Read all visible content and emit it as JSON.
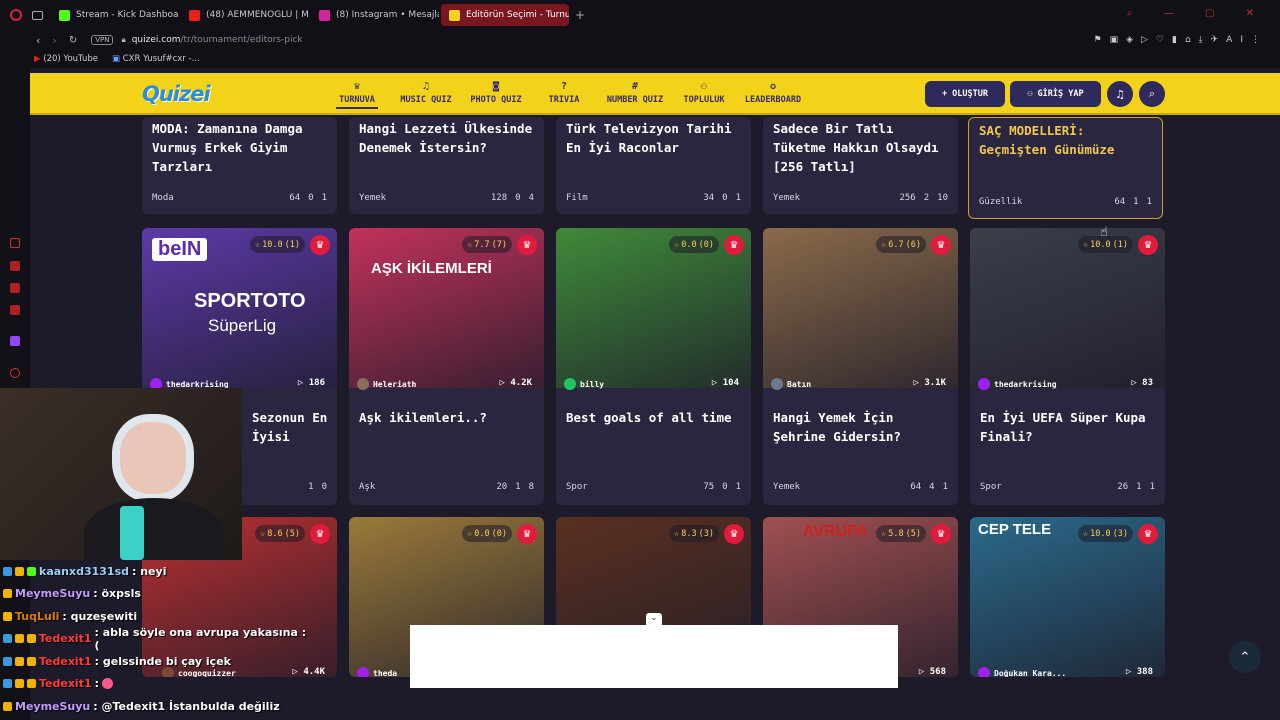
{
  "browser": {
    "tabs": [
      {
        "label": "Stream - Kick Dashboard",
        "color": "#53fc18"
      },
      {
        "label": "(48) AEMMENOGLU | Mar",
        "color": "#e62117"
      },
      {
        "label": "(8) Instagram • Mesajlar",
        "color": "#d6249f"
      },
      {
        "label": "Editörün Seçimi - Turnuva",
        "color": "#f3d31a"
      }
    ],
    "url_host": "quizei.com",
    "url_path": "/tr/tournament/editors-pick",
    "vpn_label": "VPN",
    "bookmarks": [
      "(20) YouTube",
      "CXR Yusuf#cxr -..."
    ]
  },
  "header": {
    "logo": "Quizei",
    "nav": [
      {
        "label": "TURNUVA",
        "icon": "trophy-icon"
      },
      {
        "label": "MUSIC QUIZ",
        "icon": "music-icon"
      },
      {
        "label": "PHOTO QUIZ",
        "icon": "camera-icon"
      },
      {
        "label": "TRIVIA",
        "icon": "question-icon"
      },
      {
        "label": "NUMBER QUIZ",
        "icon": "hash-icon"
      },
      {
        "label": "TOPLULUK",
        "icon": "users-icon"
      },
      {
        "label": "LEADERBOARD",
        "icon": "medal-icon"
      }
    ],
    "create_label": "OLUŞTUR",
    "login_label": "GİRİŞ YAP"
  },
  "top_row": [
    {
      "title": "MODA: Zamanına Damga Vurmuş Erkek Giyim Tarzları",
      "category": "Moda",
      "items": "64",
      "comments": "0",
      "likes": "1"
    },
    {
      "title": "Hangi Lezzeti Ülkesinde Denemek İstersin?",
      "category": "Yemek",
      "items": "128",
      "comments": "0",
      "likes": "4"
    },
    {
      "title": "Türk Televizyon Tarihi En İyi Raconlar",
      "category": "Film",
      "items": "34",
      "comments": "0",
      "likes": "1"
    },
    {
      "title": "Sadece Bir Tatlı Tüketme Hakkın Olsaydı [256 Tatlı]",
      "category": "Yemek",
      "items": "256",
      "comments": "2",
      "likes": "10"
    },
    {
      "title": "SAÇ MODELLERİ: Geçmişten Günümüze",
      "category": "Güzellik",
      "items": "64",
      "comments": "1",
      "likes": "1"
    }
  ],
  "mid_row": [
    {
      "rating": "10.0",
      "votes": "(1)",
      "author": "thedarkrising",
      "plays": "186",
      "title": "Sezonun En İyisi",
      "category": "",
      "items": "",
      "comments": "1",
      "likes": "0",
      "thumb": "#5c3aa8",
      "av": "#a020f0"
    },
    {
      "rating": "7.7",
      "votes": "(7)",
      "author": "Heleriath",
      "plays": "4.2K",
      "title": "Aşk ikilemleri..?",
      "category": "Aşk",
      "items": "20",
      "comments": "1",
      "likes": "8",
      "thumb": "#c2325a",
      "av": "#8b6d5c"
    },
    {
      "rating": "0.0",
      "votes": "(0)",
      "author": "billy",
      "plays": "104",
      "title": "Best goals of all time",
      "category": "Spor",
      "items": "75",
      "comments": "0",
      "likes": "1",
      "thumb": "#3f8a3a",
      "av": "#22c55e"
    },
    {
      "rating": "6.7",
      "votes": "(6)",
      "author": "Batın",
      "plays": "3.1K",
      "title": "Hangi Yemek İçin Şehrine Gidersin?",
      "category": "Yemek",
      "items": "64",
      "comments": "4",
      "likes": "1",
      "thumb": "#8a6a4a",
      "av": "#6b7b8c"
    },
    {
      "rating": "10.0",
      "votes": "(1)",
      "author": "thedarkrising",
      "plays": "83",
      "title": "En İyi UEFA Süper Kupa Finali?",
      "category": "Spor",
      "items": "26",
      "comments": "1",
      "likes": "1",
      "thumb": "#3a3f48",
      "av": "#a020f0"
    }
  ],
  "bottom_row": [
    {
      "rating": "8.6",
      "votes": "(5)",
      "author": "",
      "plays": "4.4K",
      "thumb": "#b93030"
    },
    {
      "rating": "0.0",
      "votes": "(0)",
      "author": "theda",
      "plays": "",
      "thumb": "#9a7a3a"
    },
    {
      "rating": "8.3",
      "votes": "(3)",
      "author": "",
      "plays": "",
      "thumb": "#5a3020"
    },
    {
      "rating": "5.8",
      "votes": "(5)",
      "author": "",
      "plays": "568",
      "thumb": "#a05050"
    },
    {
      "rating": "10.0",
      "votes": "(3)",
      "author": "Doğukan Kara...",
      "plays": "388",
      "thumb": "#2a6a8a"
    }
  ],
  "thumb_text": {
    "bein": "beIN",
    "sportoto": "SPORTOTO",
    "superlig": "SüperLig",
    "ask": "AŞK İKİLEMLERİ",
    "avrupa": "AVRUPA",
    "cep": "CEP TELE"
  },
  "chat": [
    {
      "user": "kaanxd3131sd",
      "msg": ": neyi",
      "color": "#9ad0f5"
    },
    {
      "user": "MeymeSuyu",
      "msg": ": öxpsls",
      "color": "#c39bff"
    },
    {
      "user": "TuqLuli",
      "msg": ": quzeşewiti",
      "color": "#e07b00"
    },
    {
      "user": "Tedexit1",
      "msg": ": abla söyle ona avrupa yakasına :(",
      "color": "#ff3b3b"
    },
    {
      "user": "Tedexit1",
      "msg": ": gelssinde bi çay içek",
      "color": "#ff3b3b"
    },
    {
      "user": "Tedexit1",
      "msg": ":",
      "color": "#ff3b3b"
    },
    {
      "user": "MeymeSuyu",
      "msg": ": @Tedexit1 İstanbulda değiliz",
      "color": "#c39bff"
    }
  ],
  "extra": {
    "author_b1": "coogoquizzer"
  }
}
